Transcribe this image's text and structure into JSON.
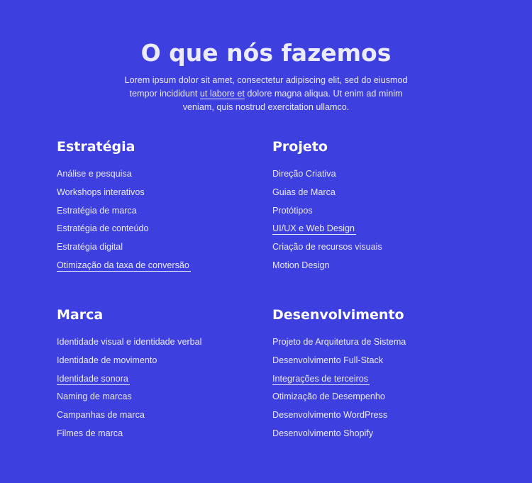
{
  "header": {
    "title": "O que nós fazemos",
    "intro_before": "Lorem ipsum dolor sit amet, consectetur adipiscing elit, sed do eiusmod tempor incididunt ",
    "intro_link": "ut labore et",
    "intro_after": " dolore magna aliqua. Ut enim ad minim veniam, quis nostrud exercitation ullamco."
  },
  "sections": [
    {
      "title": "Estratégia",
      "items": [
        {
          "label": "Análise e pesquisa",
          "underlined": false
        },
        {
          "label": "Workshops interativos",
          "underlined": false
        },
        {
          "label": "Estratégia de marca",
          "underlined": false
        },
        {
          "label": "Estratégia de conteúdo",
          "underlined": false
        },
        {
          "label": "Estratégia digital",
          "underlined": false
        },
        {
          "label": "Otimização da taxa de conversão",
          "underlined": true
        }
      ]
    },
    {
      "title": "Projeto",
      "items": [
        {
          "label": "Direção Criativa",
          "underlined": false
        },
        {
          "label": "Guias de Marca",
          "underlined": false
        },
        {
          "label": "Protótipos",
          "underlined": false
        },
        {
          "label": "UI/UX e Web Design",
          "underlined": true
        },
        {
          "label": "Criação de recursos visuais",
          "underlined": false
        },
        {
          "label": "Motion Design",
          "underlined": false
        }
      ]
    },
    {
      "title": "Marca",
      "items": [
        {
          "label": "Identidade visual e identidade verbal",
          "underlined": false
        },
        {
          "label": "Identidade de movimento",
          "underlined": false
        },
        {
          "label": "Identidade sonora",
          "underlined": true
        },
        {
          "label": "Naming de marcas",
          "underlined": false
        },
        {
          "label": "Campanhas de marca",
          "underlined": false
        },
        {
          "label": "Filmes de marca",
          "underlined": false
        }
      ]
    },
    {
      "title": "Desenvolvimento",
      "items": [
        {
          "label": "Projeto de Arquitetura de Sistema",
          "underlined": false
        },
        {
          "label": "Desenvolvimento Full-Stack",
          "underlined": false
        },
        {
          "label": "Integrações de terceiros",
          "underlined": true
        },
        {
          "label": "Otimização de Desempenho",
          "underlined": false
        },
        {
          "label": "Desenvolvimento WordPress",
          "underlined": false
        },
        {
          "label": "Desenvolvimento Shopify",
          "underlined": false
        }
      ]
    }
  ],
  "colors": {
    "background": "#3d3fde",
    "text": "#ecebfb"
  }
}
